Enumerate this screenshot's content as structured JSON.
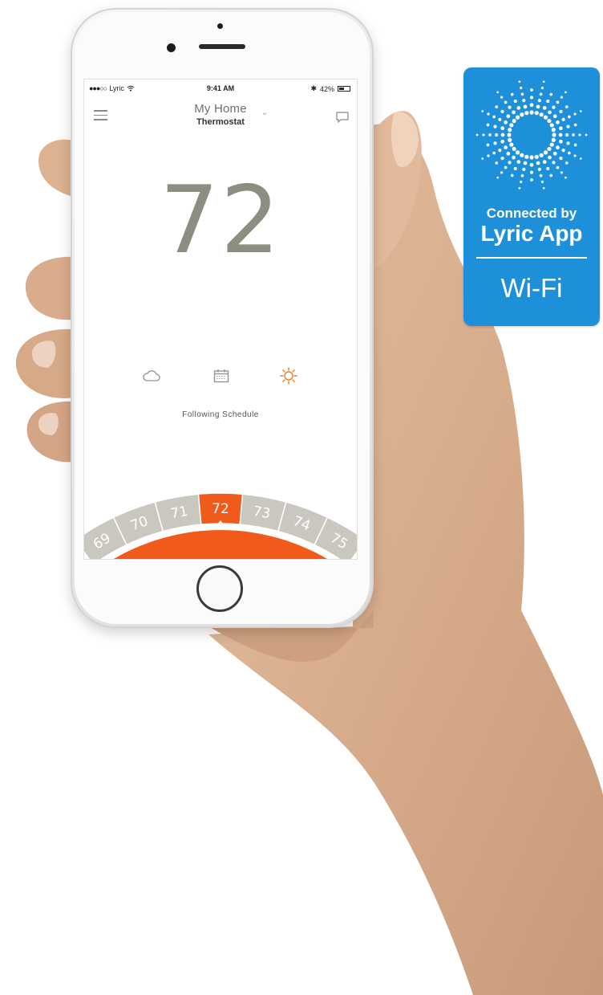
{
  "status_bar": {
    "carrier": "Lyric",
    "time": "9:41 AM",
    "battery": "42%"
  },
  "header": {
    "location": "My Home",
    "device": "Thermostat"
  },
  "thermostat": {
    "current_temp": "72",
    "status": "Following Schedule",
    "modes": [
      {
        "icon": "cloud-icon"
      },
      {
        "icon": "calendar-icon"
      },
      {
        "icon": "sun-icon",
        "active": true
      }
    ]
  },
  "setpoint_dial": {
    "values": [
      "69",
      "70",
      "71",
      "72",
      "73",
      "74",
      "75"
    ],
    "selected": "72",
    "accent_color": "#f05a1a",
    "track_color": "#c9c7c0"
  },
  "badge": {
    "line1": "Connected by",
    "line2": "Lyric App",
    "line3": "Wi-Fi",
    "color": "#1e8fd9"
  }
}
